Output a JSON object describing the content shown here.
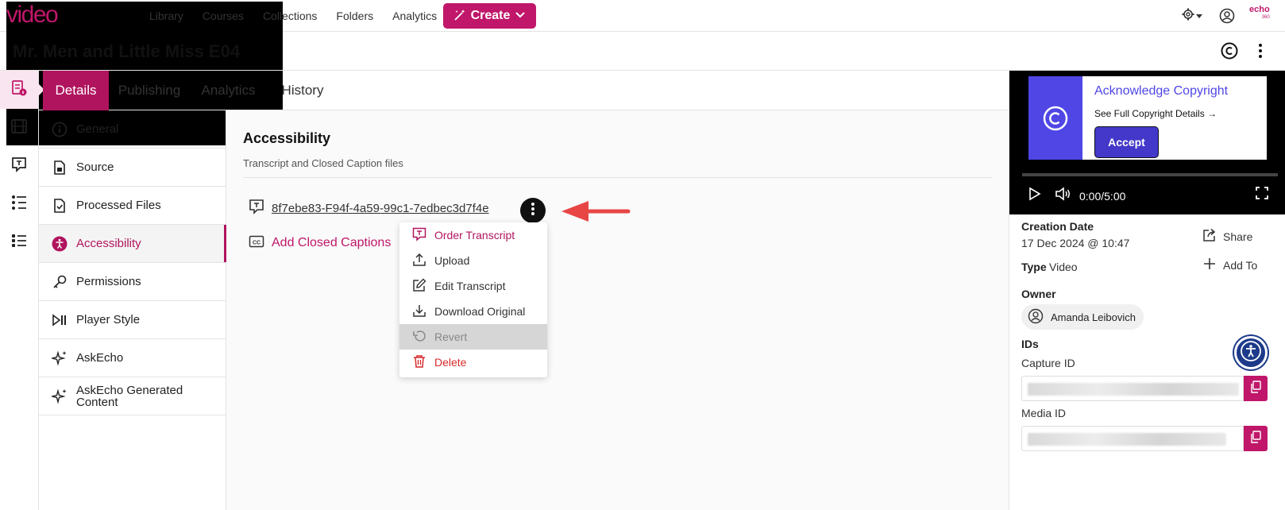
{
  "brand": {
    "logo_echo": "echo",
    "logo_video": "video",
    "corner_logo": "echo",
    "corner_logo_sub": "360"
  },
  "nav": {
    "links": [
      "Library",
      "Courses",
      "Collections",
      "Folders",
      "Analytics"
    ],
    "create_label": "Create"
  },
  "page": {
    "title": "Mr. Men and Little Miss E04"
  },
  "tabs": [
    "Details",
    "Publishing",
    "Analytics",
    "History"
  ],
  "sections": [
    "General",
    "Source",
    "Processed Files",
    "Accessibility",
    "Permissions",
    "Player Style",
    "AskEcho",
    "AskEcho Generated Content"
  ],
  "accessibility": {
    "title": "Accessibility",
    "subtitle": "Transcript and Closed Caption files",
    "transcript_file": "8f7ebe83-F94f-4a59-99c1-7edbec3d7f4e",
    "add_cc_label": "Add Closed Captions"
  },
  "menu": [
    "Order Transcript",
    "Upload",
    "Edit Transcript",
    "Download Original",
    "Revert",
    "Delete"
  ],
  "copyright": {
    "title": "Acknowledge Copyright",
    "link": "See Full Copyright Details",
    "accept": "Accept"
  },
  "player": {
    "time": "0:00/5:00"
  },
  "details": {
    "creation_label": "Creation Date",
    "creation_value": "17 Dec 2024 @ 10:47",
    "type_label": "Type",
    "type_value": "Video",
    "owner_label": "Owner",
    "owner_name": "Amanda Leibovich",
    "ids_label": "IDs",
    "capture_label": "Capture ID",
    "media_label": "Media ID",
    "share_label": "Share",
    "addto_label": "Add To"
  },
  "colors": {
    "brand": "#c0176a",
    "tab_active": "#b0145e",
    "copyright_accent": "#4f46e5",
    "danger": "#d62a2a"
  }
}
